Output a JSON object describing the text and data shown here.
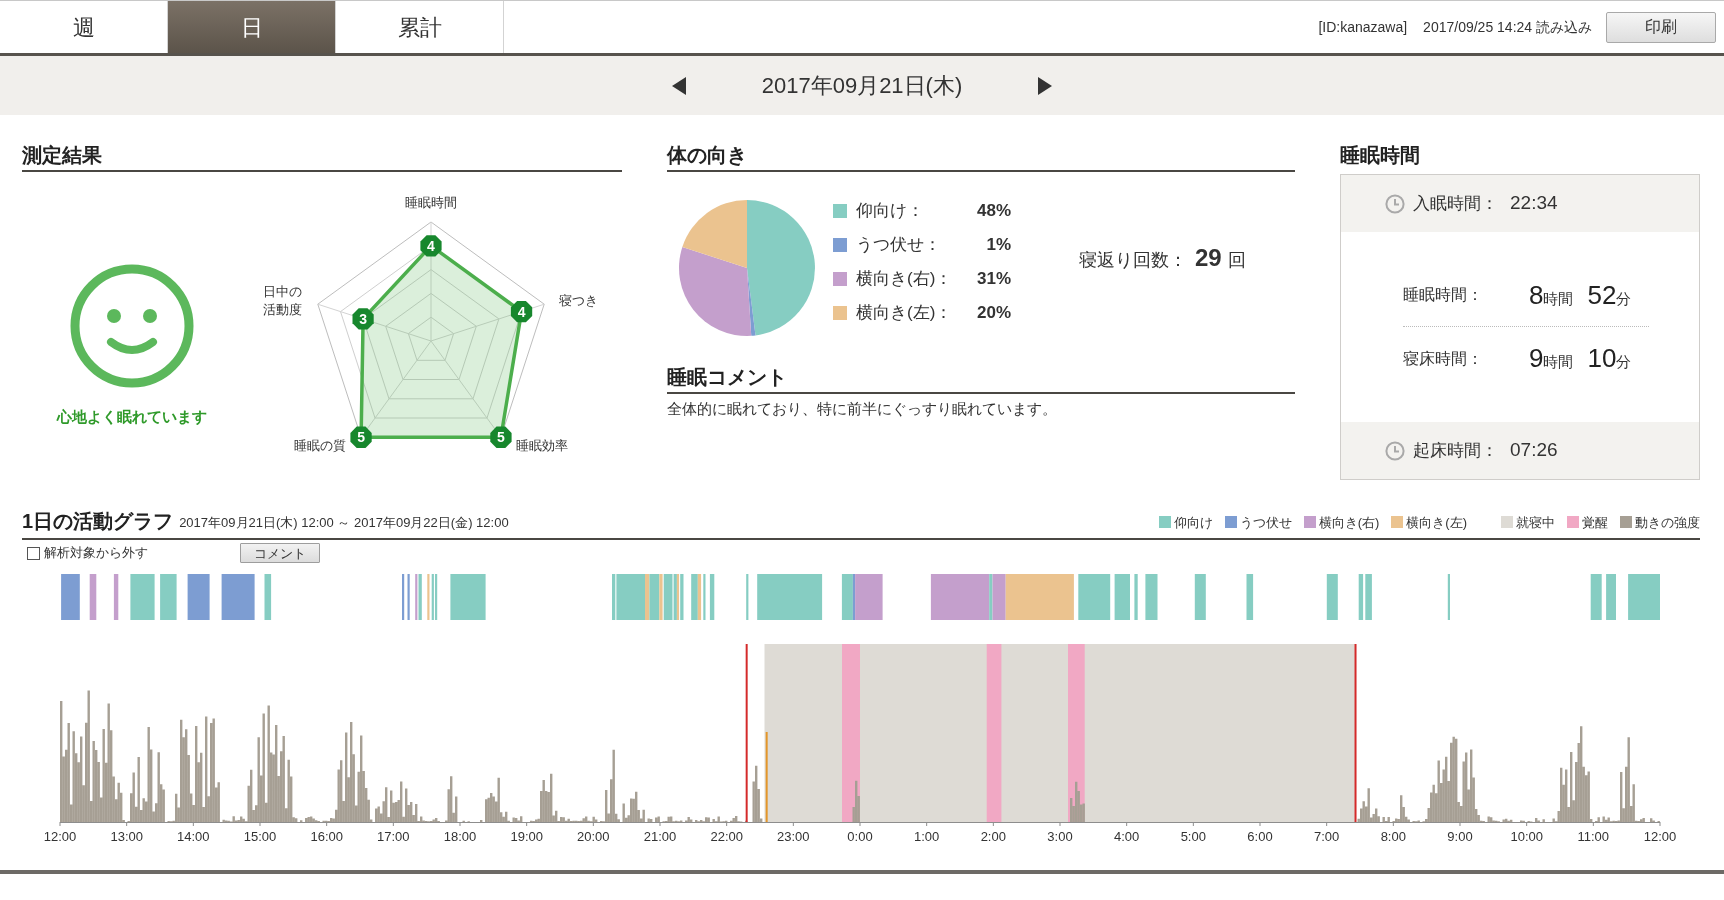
{
  "tabs": [
    {
      "label": "週",
      "selected": false
    },
    {
      "label": "日",
      "selected": true
    },
    {
      "label": "累計",
      "selected": false
    }
  ],
  "header": {
    "user_id": "[ID:kanazawa]",
    "loaded_at": "2017/09/25 14:24 読み込み",
    "print_button": "印刷"
  },
  "date_nav": {
    "date": "2017年09月21日(木)"
  },
  "measurement": {
    "title": "測定結果",
    "mood": "心地よく眠れています",
    "radar": {
      "axes": [
        {
          "label": "睡眠時間",
          "score": "4"
        },
        {
          "label": "日中の活動度",
          "score": "3"
        },
        {
          "label": "寝つき",
          "score": "4"
        },
        {
          "label": "睡眠の質",
          "score": "5"
        },
        {
          "label": "睡眠効率",
          "score": "5"
        }
      ]
    }
  },
  "body_orientation": {
    "title": "体の向き",
    "chart_data": {
      "type": "pie",
      "values": [
        48,
        1,
        31,
        20
      ]
    },
    "legend": [
      {
        "label": "仰向け：",
        "value": "48%",
        "color": "#86cdc2"
      },
      {
        "label": "うつ伏せ：",
        "value": "1%",
        "color": "#7d9dd2"
      },
      {
        "label": "横向き(右)：",
        "value": "31%",
        "color": "#c49fcc"
      },
      {
        "label": "横向き(左)：",
        "value": "20%",
        "color": "#ebc38f"
      }
    ],
    "turn_count": {
      "label": "寝返り回数：",
      "value": "29",
      "unit": "回"
    }
  },
  "sleep_comment": {
    "title": "睡眠コメント",
    "text": "全体的に眠れており、特に前半にぐっすり眠れています。"
  },
  "sleep_time": {
    "title": "睡眠時間",
    "onset": {
      "label": "入眠時間：",
      "value": "22:34"
    },
    "durations": [
      {
        "label": "睡眠時間：",
        "hours": "8",
        "hours_unit": "時間",
        "minutes": "52",
        "minutes_unit": "分"
      },
      {
        "label": "寝床時間：",
        "hours": "9",
        "hours_unit": "時間",
        "minutes": "10",
        "minutes_unit": "分"
      }
    ],
    "wake": {
      "label": "起床時間：",
      "value": "07:26"
    }
  },
  "activity": {
    "title": "1日の活動グラフ",
    "range": "2017年09月21日(木) 12:00 ～ 2017年09月22日(金) 12:00",
    "legend": [
      {
        "kind": "supine",
        "label": "仰向け",
        "color": "#86cdc2"
      },
      {
        "kind": "prone",
        "label": "うつ伏せ",
        "color": "#7d9dd2"
      },
      {
        "kind": "side_right",
        "label": "横向き(右)",
        "color": "#c49fcc"
      },
      {
        "kind": "side_left",
        "label": "横向き(左)",
        "color": "#ebc38f"
      },
      {
        "kind": "in_bed",
        "label": "就寝中",
        "color": "#dedbd5"
      },
      {
        "kind": "awake",
        "label": "覚醒",
        "color": "#f1a8c4"
      },
      {
        "kind": "movement",
        "label": "動きの強度",
        "color": "#a69f94"
      }
    ],
    "exclude": {
      "label": "解析対象から外す",
      "checked": false
    },
    "comment_button": "コメント",
    "time_axis": [
      "12:00",
      "13:00",
      "14:00",
      "15:00",
      "16:00",
      "17:00",
      "18:00",
      "19:00",
      "20:00",
      "21:00",
      "22:00",
      "23:00",
      "0:00",
      "1:00",
      "2:00",
      "3:00",
      "4:00",
      "5:00",
      "6:00",
      "7:00",
      "8:00",
      "9:00",
      "10:00",
      "11:00",
      "12:00"
    ]
  }
}
